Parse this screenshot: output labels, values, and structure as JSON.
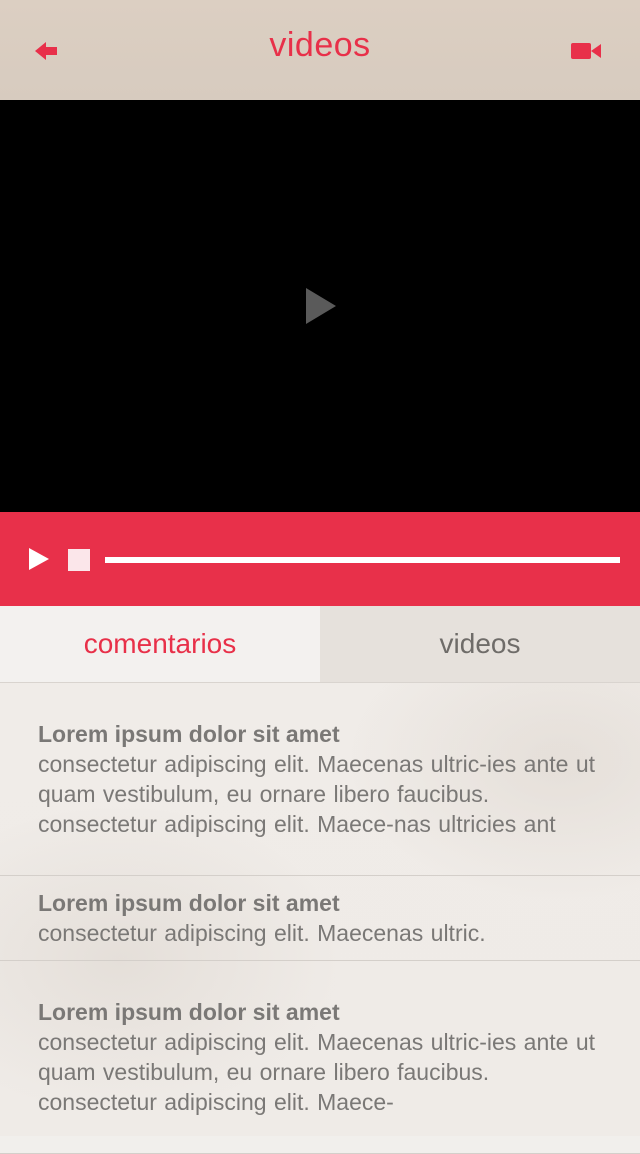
{
  "header": {
    "title": "videos",
    "back_icon": "arrow-left-icon",
    "camera_icon": "video-camera-icon"
  },
  "colors": {
    "accent": "#e8304a",
    "header_bg": "#d9ccbf",
    "video_bg": "#000000",
    "text_muted": "#7a7876"
  },
  "player": {
    "center_icon": "play-icon",
    "play_icon": "play-icon",
    "stop_icon": "stop-icon",
    "progress": 1.0
  },
  "tabs": [
    {
      "label": "comentarios",
      "active": true
    },
    {
      "label": "videos",
      "active": false
    }
  ],
  "comments": [
    {
      "title": "Lorem ipsum dolor sit amet",
      "body": "consectetur adipiscing elit. Maecenas ultric-ies ante ut quam vestibulum, eu ornare libero faucibus. consectetur adipiscing elit. Maece-nas ultricies ant"
    },
    {
      "title": "Lorem ipsum dolor sit amet",
      "body": "consectetur adipiscing elit. Maecenas ultric."
    },
    {
      "title": "Lorem ipsum dolor sit amet",
      "body": "consectetur adipiscing elit. Maecenas ultric-ies ante ut quam vestibulum, eu ornare libero faucibus. consectetur adipiscing elit. Maece-"
    }
  ]
}
